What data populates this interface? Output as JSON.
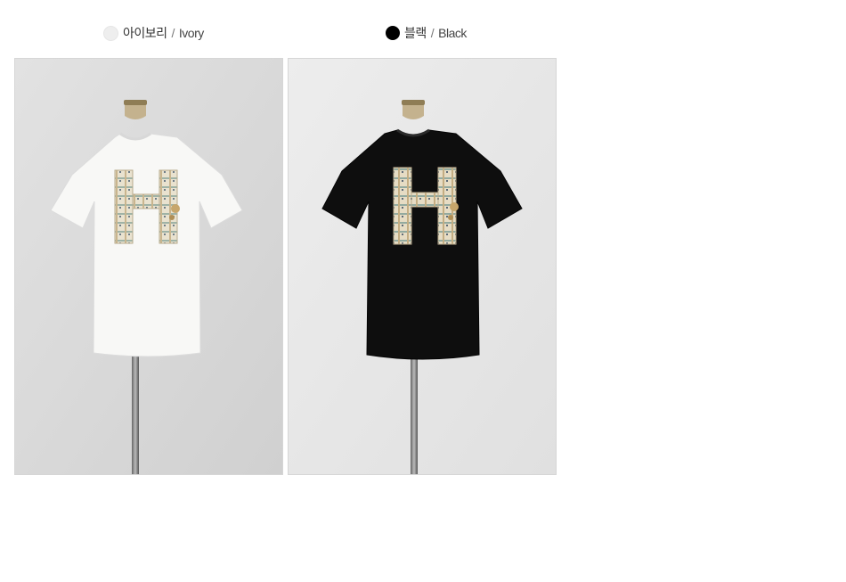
{
  "colors": [
    {
      "korean": "아이보리",
      "separator": "/",
      "english": "Ivory",
      "swatch": "#eeeeee",
      "swatch_icon": "ivory-swatch-icon"
    },
    {
      "korean": "블랙",
      "separator": "/",
      "english": "Black",
      "swatch": "#000000",
      "swatch_icon": "black-swatch-icon"
    }
  ],
  "photos": [
    {
      "name": "ivory-tshirt-photo",
      "shirt_color": "#f7f7f5",
      "background": "#dcdcdc"
    },
    {
      "name": "black-tshirt-photo",
      "shirt_color": "#0d0d0d",
      "background": "#e9e9e9"
    }
  ]
}
